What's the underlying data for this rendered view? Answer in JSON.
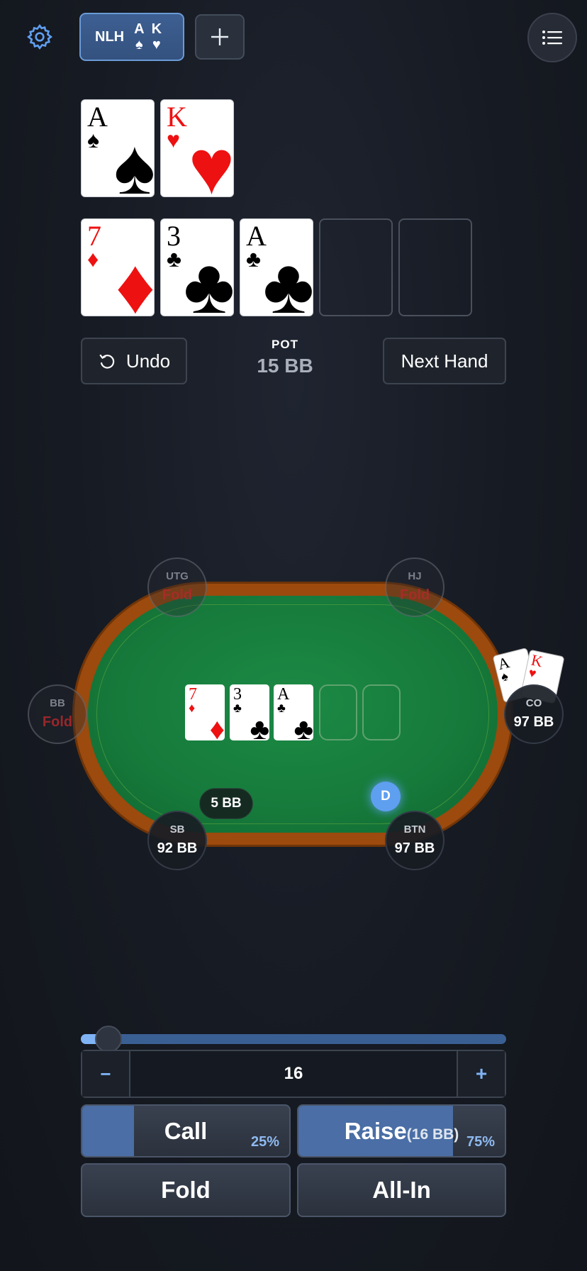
{
  "topbar": {
    "settings_icon": "gear-icon",
    "hand_tab": {
      "game": "NLH",
      "cards": [
        {
          "rank": "A",
          "suit": "♠"
        },
        {
          "rank": "K",
          "suit": "♥"
        }
      ]
    },
    "add_icon": "plus-icon",
    "menu_icon": "list-icon"
  },
  "hole_cards": [
    {
      "rank": "A",
      "suit": "♠",
      "color": "black"
    },
    {
      "rank": "K",
      "suit": "♥",
      "color": "red"
    }
  ],
  "board": [
    {
      "rank": "7",
      "suit": "♦",
      "color": "red"
    },
    {
      "rank": "3",
      "suit": "♣",
      "color": "black"
    },
    {
      "rank": "A",
      "suit": "♣",
      "color": "black"
    }
  ],
  "controls": {
    "undo_label": "Undo",
    "pot_label": "POT",
    "pot_value": "15 BB",
    "next_hand_label": "Next Hand"
  },
  "seats": {
    "utg": {
      "pos": "UTG",
      "status": "Fold"
    },
    "hj": {
      "pos": "HJ",
      "status": "Fold"
    },
    "bb": {
      "pos": "BB",
      "status": "Fold"
    },
    "co": {
      "pos": "CO",
      "stack": "97 BB"
    },
    "sb": {
      "pos": "SB",
      "stack": "92 BB"
    },
    "btn": {
      "pos": "BTN",
      "stack": "97 BB"
    }
  },
  "table": {
    "bet": "5 BB",
    "dealer_button": "D",
    "hero_cards": [
      {
        "rank": "A",
        "suit": "♠"
      },
      {
        "rank": "K",
        "suit": "♥"
      }
    ]
  },
  "bet_sizer": {
    "slider_fraction": 0.04,
    "minus": "−",
    "value": "16",
    "plus": "+"
  },
  "actions": {
    "call": {
      "label": "Call",
      "freq": "25%",
      "freq_value": 0.25
    },
    "raise": {
      "label": "Raise",
      "amount": "(16 BB)",
      "freq": "75%",
      "freq_value": 0.75
    },
    "fold": {
      "label": "Fold"
    },
    "allin": {
      "label": "All-In"
    }
  },
  "colors": {
    "accent": "#5f9ff0",
    "felt": "#167a3b",
    "rail": "#9c4a0d",
    "fold_red": "#b0292b"
  }
}
